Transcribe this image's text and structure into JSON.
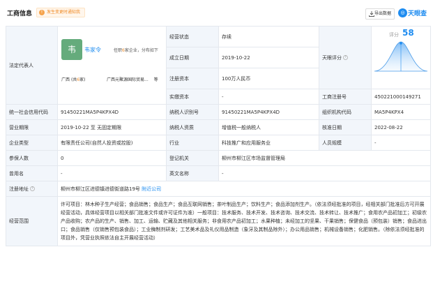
{
  "header": {
    "title": "工商信息",
    "warning": "发生变更时通知我",
    "export_label": "导出数据",
    "brand": "天眼查"
  },
  "legal_rep": {
    "label": "法定代表人",
    "avatar_char": "韦",
    "name": "韦家令",
    "desc_prefix": "任职",
    "desc_count": "6",
    "desc_suffix": "家企业，分布如下",
    "region_name": "广西",
    "region_count_prefix": "(共",
    "region_count": "6",
    "region_count_suffix": "家)",
    "company_hint": "广西元聚源国际贸易...",
    "more": "等"
  },
  "rows": {
    "status": {
      "label": "经营状态",
      "value": "存续"
    },
    "established": {
      "label": "成立日期",
      "value": "2019-10-22"
    },
    "reg_capital": {
      "label": "注册资本",
      "value": "100万人民币"
    },
    "paid_capital": {
      "label": "实缴资本",
      "value": "-"
    },
    "score": {
      "label": "天眼评分",
      "score_label": "评分",
      "score_value": "58"
    },
    "reg_no": {
      "label": "工商注册号",
      "value": "450221000149271"
    },
    "credit_code": {
      "label": "统一社会信用代码",
      "value": "91450221MA5P4KPX4D"
    },
    "taxpayer_id": {
      "label": "纳税人识别号",
      "value": "91450221MA5P4KPX4D"
    },
    "org_code": {
      "label": "组织机构代码",
      "value": "MA5P4KPX4"
    },
    "term": {
      "label": "营业期限",
      "value": "2019-10-22 至 无固定期限"
    },
    "taxpayer_type": {
      "label": "纳税人资质",
      "value": "增值税一般纳税人"
    },
    "approval_date": {
      "label": "核准日期",
      "value": "2022-08-22"
    },
    "company_type": {
      "label": "企业类型",
      "value": "有限责任公司(自然人投资或控股)"
    },
    "industry": {
      "label": "行业",
      "value": "科技推广和应用服务业"
    },
    "staff_size": {
      "label": "人员规模",
      "value": "-"
    },
    "insured": {
      "label": "参保人数",
      "value": "0"
    },
    "registration_authority": {
      "label": "登记机关",
      "value": "柳州市柳江区市场监督管理局"
    },
    "former_name": {
      "label": "曾用名",
      "value": "-"
    },
    "english_name": {
      "label": "英文名称",
      "value": "-"
    },
    "address": {
      "label": "注册地址",
      "value": "柳州市柳江区进德镇进德街道路19号",
      "nearby": "附近公司"
    },
    "scope": {
      "label": "经营范围",
      "value": "许可项目：林木种子生产经营；食品销售；食品生产；食品互联网销售；茶叶制品生产；饮料生产；食品添加剂生产。（依法须经批准的项目，经相关部门批准后方可开展经营活动，具体经营项目以相关部门批准文件或许可证件为准）一般项目：技术服务、技术开发、技术咨询、技术交流、技术转让、技术推广；食用农产品初加工；初级农产品收购；农产品的生产、销售、加工、运输、贮藏及其他相关服务；非食用农产品初加工；水果种植；未经加工的坚果、干果销售；保健食品（预包装）销售；食品进出口；食品销售（仅销售预包装食品）；工业酶制剂研发；工艺美术品及礼仪用品制造（象牙及其制品除外）；办公用品销售；机械设备销售；化肥销售。（除依法须经批准的项目外，凭营业执照依法自主开展经营活动）"
    }
  }
}
